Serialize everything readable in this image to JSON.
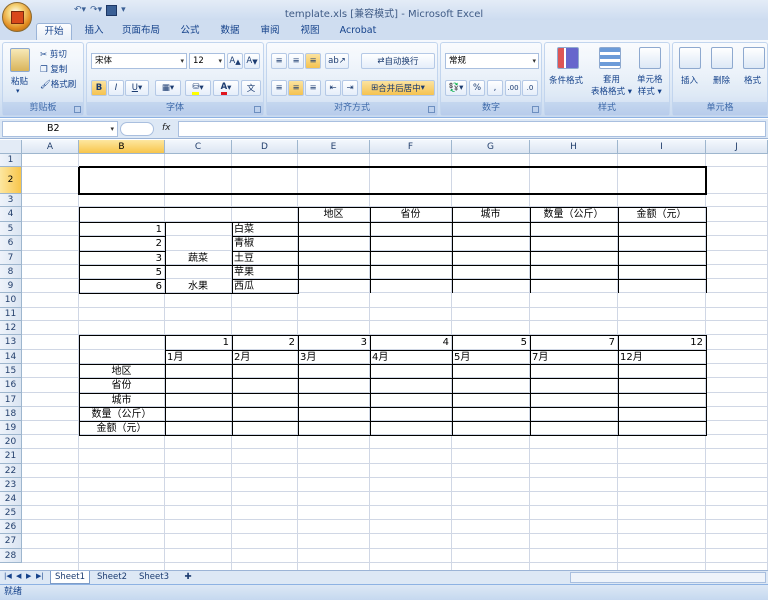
{
  "window": {
    "title": "template.xls  [兼容模式] - Microsoft Excel"
  },
  "ribbon_tabs": [
    "开始",
    "插入",
    "页面布局",
    "公式",
    "数据",
    "审阅",
    "视图",
    "Acrobat"
  ],
  "clipboard": {
    "paste": "粘贴",
    "cut": "剪切",
    "copy": "复制",
    "format_painter": "格式刷",
    "label": "剪贴板"
  },
  "font": {
    "name": "宋体",
    "size": "12",
    "bold": "B",
    "italic": "I",
    "underline": "U",
    "label": "字体"
  },
  "alignment": {
    "wrap": "自动换行",
    "merge": "合并后居中",
    "label": "对齐方式"
  },
  "number": {
    "format": "常规",
    "percent": "%",
    "comma": ",",
    "label": "数字"
  },
  "styles": {
    "conditional": "条件格式",
    "table": "套用\n表格格式",
    "cell": "单元格\n样式",
    "label": "样式"
  },
  "cells": {
    "insert": "插入",
    "delete": "删除",
    "format": "格式",
    "label": "单元格"
  },
  "formula_bar": {
    "name_box": "B2",
    "fx": "fx",
    "value": ""
  },
  "columns": [
    "A",
    "B",
    "C",
    "D",
    "E",
    "F",
    "G",
    "H",
    "I",
    "J"
  ],
  "rows": [
    "1",
    "2",
    "3",
    "4",
    "5",
    "6",
    "7",
    "8",
    "9",
    "10",
    "11",
    "12",
    "13",
    "14",
    "15",
    "16",
    "17",
    "18",
    "19",
    "20",
    "21",
    "22",
    "23",
    "24",
    "25",
    "26",
    "27",
    "28"
  ],
  "table1": {
    "headers": [
      "地区",
      "省份",
      "城市",
      "数量（公斤）",
      "金额（元）"
    ],
    "nums": [
      "1",
      "2",
      "3",
      "5",
      "6"
    ],
    "cat_veg": "蔬菜",
    "cat_fruit": "水果",
    "items": [
      "白菜",
      "青椒",
      "土豆",
      "苹果",
      "西瓜"
    ]
  },
  "table2": {
    "nums": [
      "1",
      "2",
      "3",
      "4",
      "5",
      "7",
      "12"
    ],
    "months": [
      "1月",
      "2月",
      "3月",
      "4月",
      "5月",
      "7月",
      "12月"
    ],
    "row_labels": [
      "地区",
      "省份",
      "城市",
      "数量（公斤）",
      "金额（元）"
    ]
  },
  "sheets": [
    "Sheet1",
    "Sheet2",
    "Sheet3"
  ],
  "status": "就绪"
}
